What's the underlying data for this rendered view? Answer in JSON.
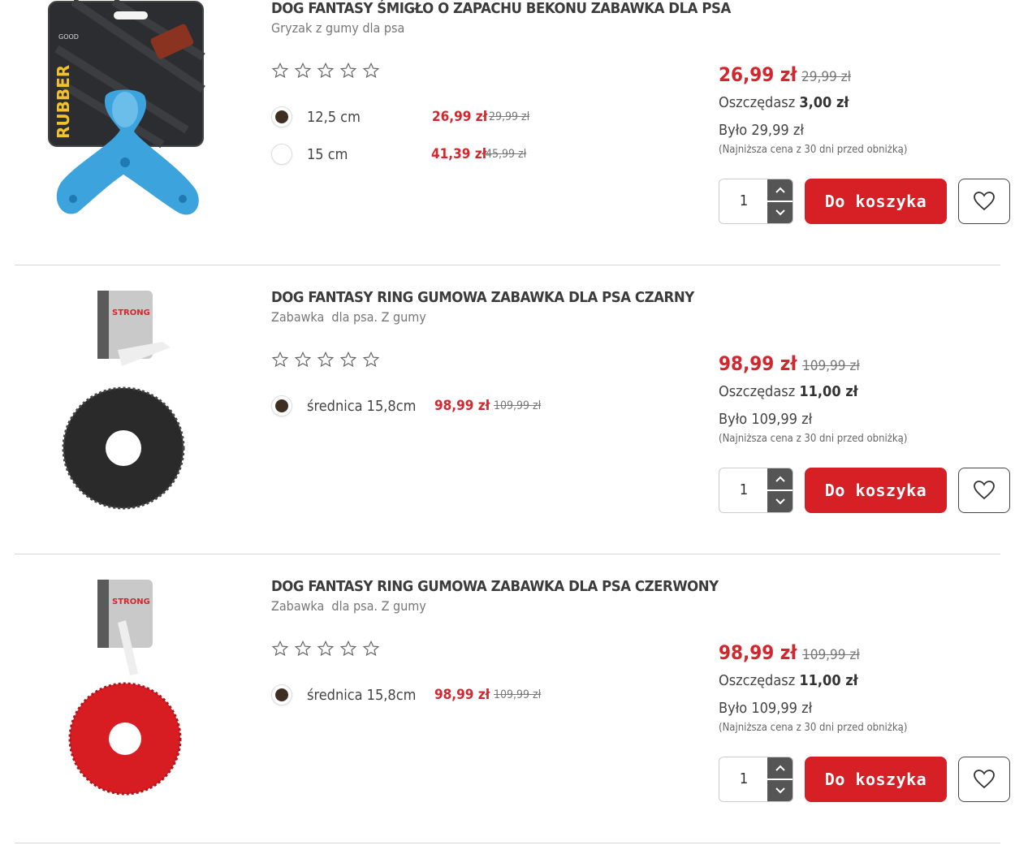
{
  "products": [
    {
      "title": "DOG FANTASY ŚMIGŁO O ZAPACHU BEKONU ZABAWKA DLA PSA",
      "subtitle": "Gryzak z gumy dla psa",
      "image": "blue-rubber-propeller-toy-in-package",
      "package_text": {
        "brand": "RUBBER",
        "top": "GOOD"
      },
      "rating": 0,
      "variants": [
        {
          "label": "12,5 cm",
          "price": "26,99 zł",
          "old": "29,99 zł",
          "selected": true
        },
        {
          "label": "15 cm",
          "price": "41,39 zł",
          "old": "45,99 zł",
          "selected": false
        }
      ],
      "price": "26,99 zł",
      "old_price": "29,99 zł",
      "save_label": "Oszczędasz",
      "save_amount": "3,00 zł",
      "was": "Było 29,99 zł",
      "lowest": "(Najniższa cena z 30 dni przed obniżką)",
      "qty": "1",
      "cart_label": "Do koszyka"
    },
    {
      "title": "DOG FANTASY RING GUMOWA ZABAWKA DLA PSA CZARNY",
      "subtitle": "Zabawka  dla psa. Z gumy",
      "image": "black-rubber-ring-toy",
      "package_text": {
        "brand": "STRONG"
      },
      "rating": 0,
      "variants": [
        {
          "label": "średnica 15,8cm",
          "price": "98,99 zł",
          "old": "109,99 zł",
          "selected": true
        }
      ],
      "price": "98,99 zł",
      "old_price": "109,99 zł",
      "save_label": "Oszczędasz",
      "save_amount": "11,00 zł",
      "was": "Było 109,99 zł",
      "lowest": "(Najniższa cena z 30 dni przed obniżką)",
      "qty": "1",
      "cart_label": "Do koszyka"
    },
    {
      "title": "DOG FANTASY RING GUMOWA ZABAWKA DLA PSA CZERWONY",
      "subtitle": "Zabawka  dla psa. Z gumy",
      "image": "red-rubber-ring-toy",
      "package_text": {
        "brand": "STRONG"
      },
      "rating": 0,
      "variants": [
        {
          "label": "średnica 15,8cm",
          "price": "98,99 zł",
          "old": "109,99 zł",
          "selected": true
        }
      ],
      "price": "98,99 zł",
      "old_price": "109,99 zł",
      "save_label": "Oszczędasz",
      "save_amount": "11,00 zł",
      "was": "Było 109,99 zł",
      "lowest": "(Najniższa cena z 30 dni przed obniżką)",
      "qty": "1",
      "cart_label": "Do koszyka"
    }
  ],
  "colors": {
    "accent": "#d71f26",
    "price": "#d4262e",
    "radio": "#3e2f22"
  },
  "icons": {
    "rating": "star-outline-icon",
    "favorite": "heart-outline-icon",
    "qty_up": "chevron-up-icon",
    "qty_down": "chevron-down-icon"
  }
}
